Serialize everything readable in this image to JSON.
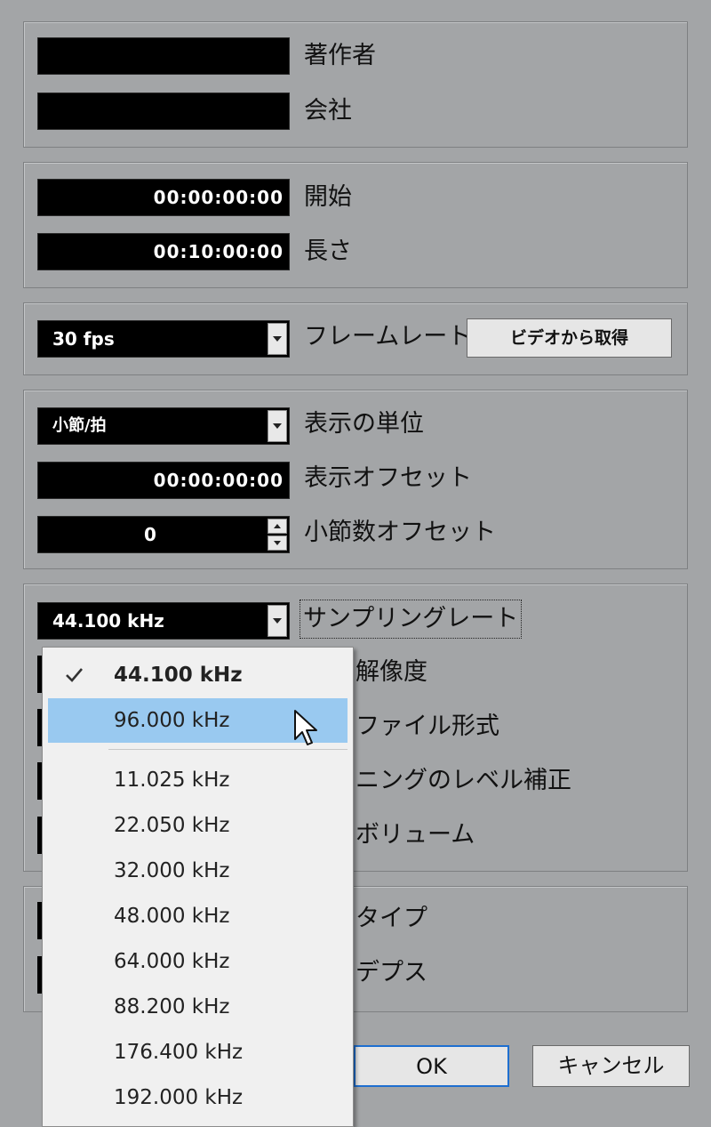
{
  "author_section": {
    "author_label": "著作者",
    "author_value": "",
    "company_label": "会社",
    "company_value": ""
  },
  "time_section": {
    "start_label": "開始",
    "start_value": "00:00:00:00",
    "length_label": "長さ",
    "length_value": "00:10:00:00"
  },
  "frame_section": {
    "framerate_value": "30 fps",
    "framerate_label": "フレームレート",
    "get_from_video_button": "ビデオから取得"
  },
  "display_section": {
    "unit_value": "小節/拍",
    "unit_label": "表示の単位",
    "offset_value": "00:00:00:00",
    "offset_label": "表示オフセット",
    "bar_offset_value": "0",
    "bar_offset_label": "小節数オフセット"
  },
  "audio_section": {
    "samplerate_value": "44.100 kHz",
    "samplerate_label": "サンプリングレート",
    "resolution_label_partial": "解像度",
    "fileformat_label_partial": "ファイル形式",
    "panning_label_partial": "ニングのレベル補正",
    "volume_label_partial": "ボリューム"
  },
  "extra_section": {
    "type_label_partial": "タイプ",
    "depth_label_partial": "デプス"
  },
  "buttons": {
    "ok": "OK",
    "cancel": "キャンセル"
  },
  "samplerate_menu": {
    "selected": "44.100 kHz",
    "hovered": "96.000 kHz",
    "primary_items": [
      "44.100 kHz",
      "96.000 kHz"
    ],
    "other_items": [
      "11.025 kHz",
      "22.050 kHz",
      "32.000 kHz",
      "48.000 kHz",
      "64.000 kHz",
      "88.200 kHz",
      "176.400 kHz",
      "192.000 kHz"
    ]
  },
  "colors": {
    "background": "#a3a5a7",
    "field": "#000000",
    "menu_hover": "#99c9f0",
    "menu_bg": "#f0f0f0"
  }
}
